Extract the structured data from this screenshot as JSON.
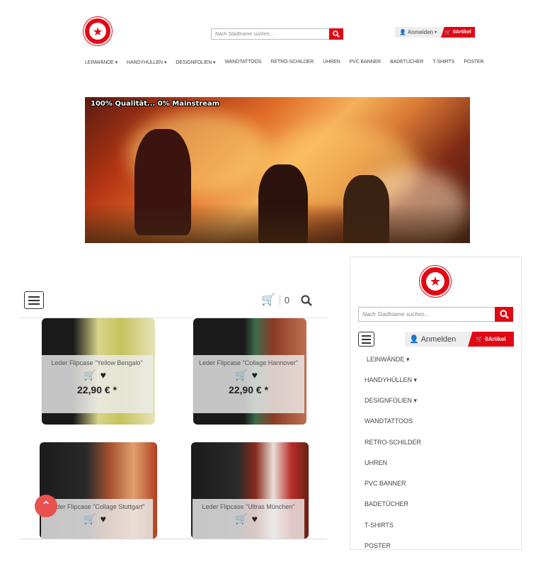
{
  "header": {
    "logo_text": "10 JAHRE ULTRAS ART",
    "search_placeholder": "Nach Stadtname suchen...",
    "login_label": "Anmelden",
    "cart_label": "0Artikel"
  },
  "nav": {
    "items": [
      {
        "label": "LEINWÄNDE",
        "dropdown": true
      },
      {
        "label": "HANDYHÜLLEN",
        "dropdown": true
      },
      {
        "label": "DESIGNFOLIEN",
        "dropdown": true
      },
      {
        "label": "WANDTATTOOS",
        "dropdown": false
      },
      {
        "label": "RETRO-SCHILDER",
        "dropdown": false
      },
      {
        "label": "UHREN",
        "dropdown": false
      },
      {
        "label": "PVC BANNER",
        "dropdown": false
      },
      {
        "label": "BADETÜCHER",
        "dropdown": false
      },
      {
        "label": "T-SHIRTS",
        "dropdown": false
      },
      {
        "label": "POSTER",
        "dropdown": false
      }
    ]
  },
  "banner": {
    "headline": "100% Qualität... 0% Mainstream"
  },
  "mobile": {
    "cart_count": "0",
    "products": [
      {
        "name": "Leder Flipcase \"Yellow Bengalo\"",
        "price": "22,90 € *"
      },
      {
        "name": "Leder Flipcase \"Collage Hannover\"",
        "price": "22,90 € *"
      },
      {
        "name": "Leder Flipcase \"Collage Stuttgart\"",
        "price": ""
      },
      {
        "name": "Leder Flipcase \"Ultras München\"",
        "price": ""
      }
    ]
  },
  "side_menu": {
    "search_placeholder": "Nach Stadtname suchen...",
    "login_label": "Anmelden",
    "cart_label": "0Artikel",
    "items": [
      {
        "label": "LEINWÄNDE",
        "dropdown": true
      },
      {
        "label": "HANDYHÜLLEN",
        "dropdown": true
      },
      {
        "label": "DESIGNFOLIEN",
        "dropdown": true
      },
      {
        "label": "WANDTATTOOS",
        "dropdown": false
      },
      {
        "label": "RETRO-SCHILDER",
        "dropdown": false
      },
      {
        "label": "UHREN",
        "dropdown": false
      },
      {
        "label": "PVC BANNER",
        "dropdown": false
      },
      {
        "label": "BADETÜCHER",
        "dropdown": false
      },
      {
        "label": "T-SHIRTS",
        "dropdown": false
      },
      {
        "label": "POSTER",
        "dropdown": false
      }
    ]
  },
  "colors": {
    "brand": "#e30613",
    "text": "#333333"
  }
}
